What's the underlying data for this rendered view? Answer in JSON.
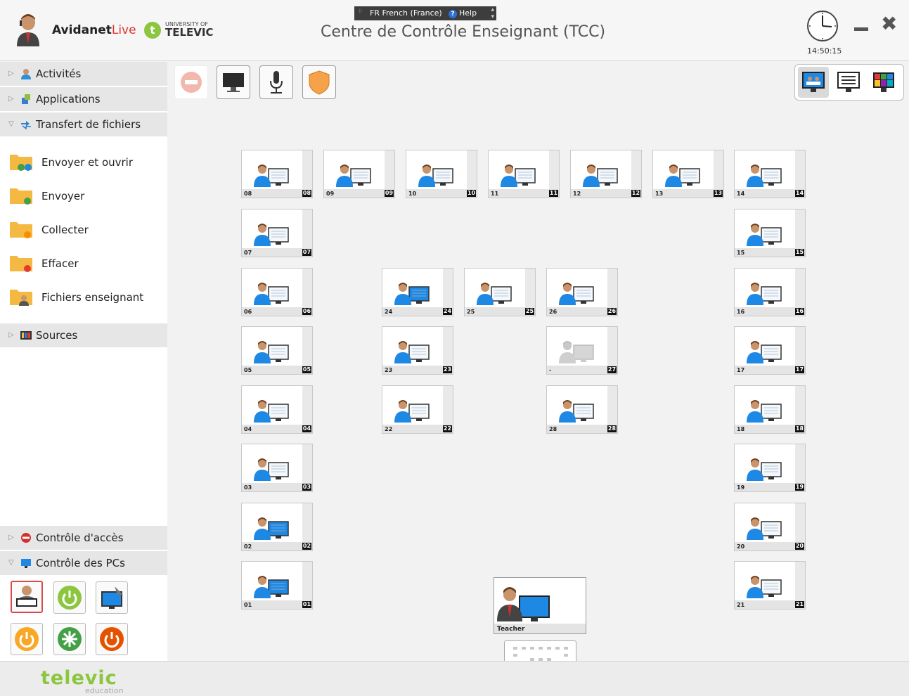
{
  "header": {
    "brand_name": "Avidanet",
    "brand_suffix": "Live",
    "university_line1": "UNIVERSITY OF",
    "university_line2": "TELEVIC",
    "university_badge": "t",
    "language_label": "FR French (France)",
    "help_label": "Help",
    "title": "Centre de Contrôle Enseignant (TCC)",
    "clock_time": "14:50:15"
  },
  "sidebar": {
    "sections": {
      "activites": "Activités",
      "applications": "Applications",
      "transfert": "Transfert de fichiers",
      "sources": "Sources",
      "controle_acces": "Contrôle d'accès",
      "controle_pcs": "Contrôle des PCs"
    },
    "file_transfer_items": [
      "Envoyer et ouvrir",
      "Envoyer",
      "Collecter",
      "Effacer",
      "Fichiers enseignant"
    ]
  },
  "classroom": {
    "seats": [
      {
        "id": "08",
        "label": "08"
      },
      {
        "id": "09",
        "label": "09"
      },
      {
        "id": "10",
        "label": "10"
      },
      {
        "id": "11",
        "label": "11"
      },
      {
        "id": "12",
        "label": "12"
      },
      {
        "id": "13",
        "label": "13"
      },
      {
        "id": "14",
        "label": "14"
      },
      {
        "id": "07",
        "label": "07"
      },
      {
        "id": "15",
        "label": "15"
      },
      {
        "id": "06",
        "label": "06"
      },
      {
        "id": "24",
        "label": "24"
      },
      {
        "id": "25",
        "label": "25"
      },
      {
        "id": "26",
        "label": "26"
      },
      {
        "id": "16",
        "label": "16"
      },
      {
        "id": "05",
        "label": "05"
      },
      {
        "id": "23",
        "label": "23"
      },
      {
        "id": "27",
        "label": "-"
      },
      {
        "id": "17",
        "label": "17"
      },
      {
        "id": "04",
        "label": "04"
      },
      {
        "id": "22",
        "label": "22"
      },
      {
        "id": "28",
        "label": "28"
      },
      {
        "id": "18",
        "label": "18"
      },
      {
        "id": "03",
        "label": "03"
      },
      {
        "id": "19",
        "label": "19"
      },
      {
        "id": "02",
        "label": "02"
      },
      {
        "id": "20",
        "label": "20"
      },
      {
        "id": "01",
        "label": "01"
      },
      {
        "id": "21",
        "label": "21"
      }
    ],
    "teacher_label": "Teacher"
  },
  "footer": {
    "brand": "televic",
    "sub": "education"
  },
  "colors": {
    "accent_red": "#e03131",
    "televic_green": "#8cc63f",
    "screen_blue": "#1e90d8"
  }
}
